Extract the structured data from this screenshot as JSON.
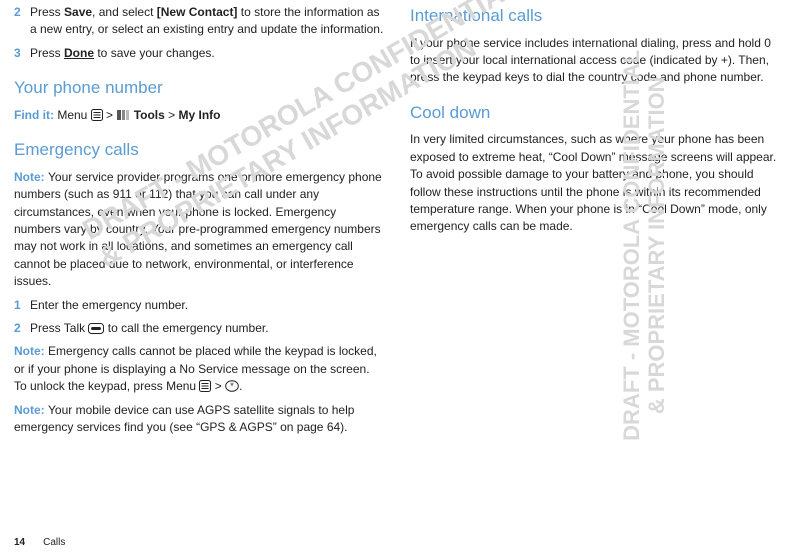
{
  "left": {
    "step2_a": "Press ",
    "step2_b": "Save",
    "step2_c": ", and select ",
    "step2_d": "[New Contact]",
    "step2_e": " to store the information as a new entry, or select an existing entry and update the information.",
    "step3_a": "Press ",
    "step3_b": "Done",
    "step3_c": " to save your changes.",
    "h_phone": "Your phone number",
    "findit": "Find it: ",
    "menu": "Menu ",
    "gt1": " > ",
    "tools": " Tools",
    "gt2": " > ",
    "myinfo": "My Info",
    "h_emerg": "Emergency calls",
    "note_lbl": "Note: ",
    "emerg_para": "Your service provider programs one or more emergency phone numbers (such as 911 or 112) that you can call under any circumstances, even when your phone is locked. Emergency numbers vary by country. Your pre-programmed emergency numbers may not work in all locations, and sometimes an emergency call cannot be placed due to network, environmental, or interference issues.",
    "e_step1": "Enter the emergency number.",
    "e_step2_a": "Press Talk ",
    "e_step2_b": " to call the emergency number.",
    "note2": "Emergency calls cannot be placed while the keypad is locked, or if your phone is displaying a No Service message on the screen. To unlock the keypad, press Menu ",
    "note2_b": " > ",
    "note2_c": ".",
    "note3": "Your mobile device can use AGPS satellite signals to help emergency services find you (see “GPS & AGPS” on page 64)."
  },
  "right": {
    "h_intl": "International calls",
    "intl_para": "If your phone service includes international dialing, press and hold 0 to insert your local international access code (indicated by +). Then, press the keypad keys to dial the country code and phone number.",
    "h_cool": "Cool down",
    "cool_para": "In very limited circumstances, such as where your phone has been exposed to extreme heat, “Cool Down” message screens will appear. To avoid possible damage to your battery and phone, you should follow these instructions until the phone is within its recommended temperature range. When your phone is in “Cool Down” mode, only emergency calls can be made."
  },
  "footer": {
    "page": "14",
    "section": "Calls"
  },
  "watermarks": {
    "left": "DRAFT - MOTOROLA CONFIDENTIAL\n& PROPRIETARY INFORMATION",
    "right": "DRAFT - MOTOROLA CONFIDENTIAL\n& PROPRIETARY INFORMATION"
  },
  "nums": {
    "n2": "2",
    "n3": "3",
    "n1": "1",
    "n2b": "2"
  }
}
